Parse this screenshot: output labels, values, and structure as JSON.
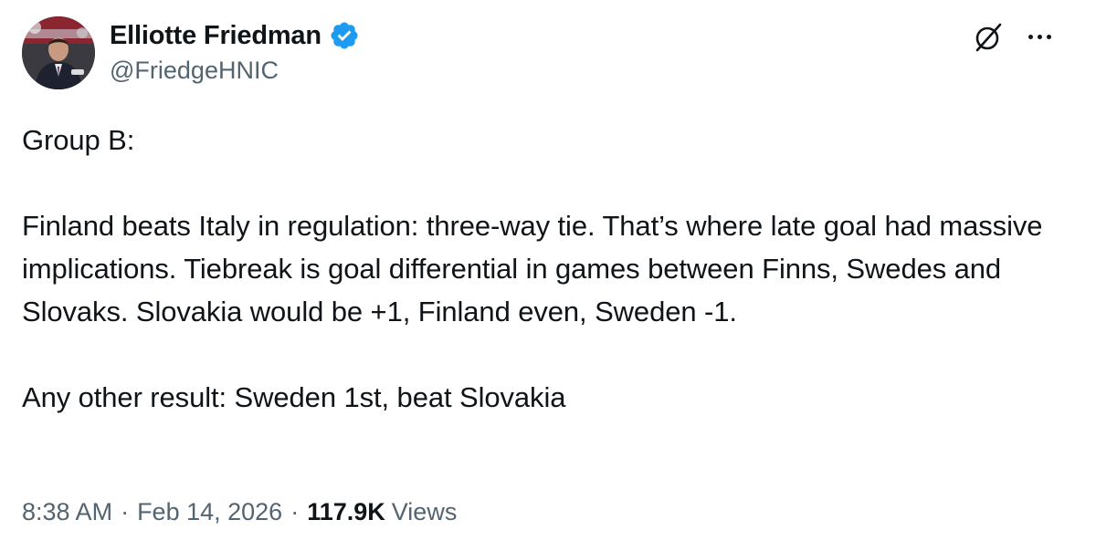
{
  "author": {
    "display_name": "Elliotte Friedman",
    "handle": "@FriedgeHNIC",
    "verified": true,
    "verified_color": "#1d9bf0"
  },
  "header_icons": {
    "grok": "grok-icon",
    "more": "more-options-icon"
  },
  "tweet": {
    "paragraphs": [
      "Group B:",
      "Finland beats Italy in regulation: three-way tie. That’s where late goal had massive implications. Tiebreak is goal differential in games between Finns, Swedes and Slovaks. Slovakia would be +1, Finland even, Sweden -1.",
      "Any other result: Sweden 1st, beat Slovakia"
    ]
  },
  "meta": {
    "time": "8:38 AM",
    "separator": "·",
    "date": "Feb 14, 2026",
    "views_count": "117.9K",
    "views_label": "Views"
  },
  "colors": {
    "text_primary": "#0f1419",
    "text_secondary": "#536471",
    "background": "#ffffff"
  }
}
